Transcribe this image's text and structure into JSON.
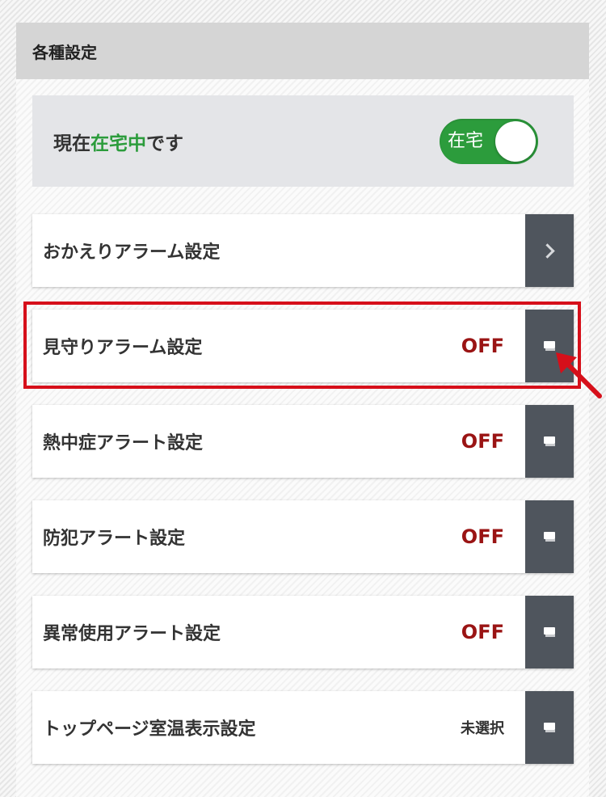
{
  "header": {
    "title": "各種設定"
  },
  "status": {
    "prefix": "現在",
    "highlight": "在宅中",
    "suffix": "です",
    "toggle_label": "在宅",
    "toggle_on": true,
    "accent": "#2c9c3c"
  },
  "rows": [
    {
      "label": "おかえりアラーム設定",
      "value": "",
      "icon": "chevron-right-icon"
    },
    {
      "label": "見守りアラーム設定",
      "value": "OFF",
      "icon": "square-icon"
    },
    {
      "label": "熱中症アラート設定",
      "value": "OFF",
      "icon": "square-icon"
    },
    {
      "label": "防犯アラート設定",
      "value": "OFF",
      "icon": "square-icon"
    },
    {
      "label": "異常使用アラート設定",
      "value": "OFF",
      "icon": "square-icon"
    },
    {
      "label": "トップページ室温表示設定",
      "value": "未選択",
      "icon": "square-icon"
    }
  ],
  "colors": {
    "off_value": "#9a1414",
    "button_bg": "#4f555d",
    "highlight_border": "#d60f1a"
  }
}
